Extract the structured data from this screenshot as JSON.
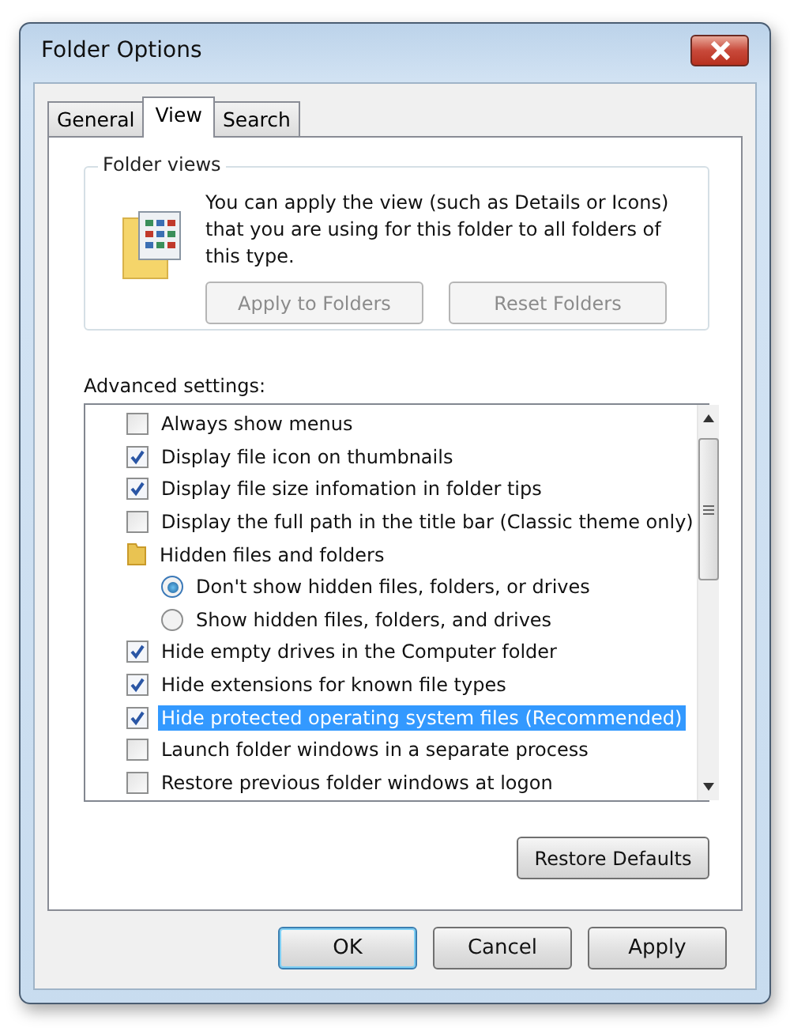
{
  "window": {
    "title": "Folder Options"
  },
  "tabs": [
    {
      "label": "General",
      "selected": false
    },
    {
      "label": "View",
      "selected": true
    },
    {
      "label": "Search",
      "selected": false
    }
  ],
  "folder_views": {
    "title": "Folder views",
    "description": "You can apply the view (such as Details or Icons) that you are using for this folder to all folders of this type.",
    "buttons": [
      {
        "label": "Apply to Folders",
        "disabled": true
      },
      {
        "label": "Reset Folders",
        "disabled": true
      }
    ]
  },
  "advanced": {
    "label": "Advanced settings:",
    "items": [
      {
        "kind": "checkbox",
        "label": "Always show menus",
        "checked": false,
        "selected": false
      },
      {
        "kind": "checkbox",
        "label": "Display file icon on thumbnails",
        "checked": true,
        "selected": false
      },
      {
        "kind": "checkbox",
        "label": "Display file size infomation in folder tips",
        "checked": true,
        "selected": false
      },
      {
        "kind": "checkbox",
        "label": "Display the full path in the title bar (Classic theme only)",
        "checked": false,
        "selected": false
      },
      {
        "kind": "group",
        "label": "Hidden files and folders",
        "selected": false,
        "children": [
          {
            "kind": "radio",
            "label": "Don't show hidden files, folders, or drives",
            "checked": true,
            "selected": false
          },
          {
            "kind": "radio",
            "label": "Show hidden files, folders, and drives",
            "checked": false,
            "selected": false
          }
        ]
      },
      {
        "kind": "checkbox",
        "label": "Hide empty drives in the Computer folder",
        "checked": true,
        "selected": false
      },
      {
        "kind": "checkbox",
        "label": "Hide extensions for known file types",
        "checked": true,
        "selected": false
      },
      {
        "kind": "checkbox",
        "label": "Hide protected operating system files (Recommended)",
        "checked": true,
        "selected": true
      },
      {
        "kind": "checkbox",
        "label": "Launch folder windows in a separate process",
        "checked": false,
        "selected": false
      },
      {
        "kind": "checkbox",
        "label": "Restore previous folder windows at logon",
        "checked": false,
        "selected": false
      }
    ],
    "restore_button": "Restore Defaults"
  },
  "buttons": [
    {
      "label": "OK",
      "default": true
    },
    {
      "label": "Cancel",
      "default": false
    },
    {
      "label": "Apply",
      "default": false
    }
  ]
}
